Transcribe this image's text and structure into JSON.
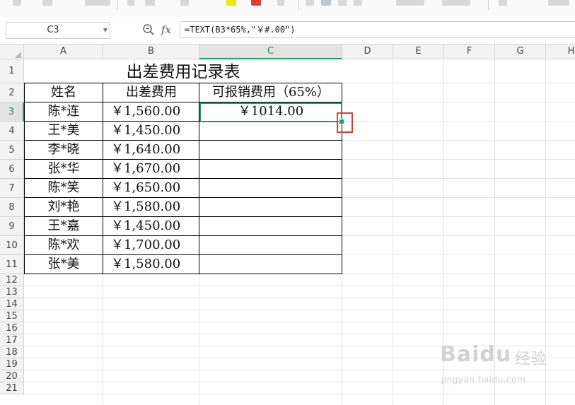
{
  "formula_bar": {
    "name_box": "C3",
    "fx_label": "fx",
    "formula": "=TEXT(B3*65%,\"￥#.00\")"
  },
  "columns": [
    "A",
    "B",
    "C",
    "D",
    "E",
    "F",
    "G",
    "H"
  ],
  "selected_column": "C",
  "rows": [
    "1",
    "2",
    "3",
    "4",
    "5",
    "6",
    "7",
    "8",
    "9",
    "10",
    "11",
    "12",
    "13",
    "14",
    "15",
    "16",
    "17",
    "18",
    "19",
    "20",
    "21"
  ],
  "selected_row": "3",
  "sheet": {
    "title": "出差费用记录表",
    "headers": [
      "姓名",
      "出差费用",
      "可报销费用（65%）"
    ],
    "records": [
      {
        "name": "陈*连",
        "cost": "￥1,560.00",
        "reimbursable": "￥1014.00"
      },
      {
        "name": "王*美",
        "cost": "￥1,450.00",
        "reimbursable": ""
      },
      {
        "name": "李*晓",
        "cost": "￥1,640.00",
        "reimbursable": ""
      },
      {
        "name": "张*华",
        "cost": "￥1,670.00",
        "reimbursable": ""
      },
      {
        "name": "陈*笑",
        "cost": "￥1,650.00",
        "reimbursable": ""
      },
      {
        "name": "刘*艳",
        "cost": "￥1,580.00",
        "reimbursable": ""
      },
      {
        "name": "王*嘉",
        "cost": "￥1,450.00",
        "reimbursable": ""
      },
      {
        "name": "陈*欢",
        "cost": "￥1,700.00",
        "reimbursable": ""
      },
      {
        "name": "张*美",
        "cost": "￥1,580.00",
        "reimbursable": ""
      }
    ]
  },
  "watermark": {
    "logo": "Baidu",
    "cn": "经验",
    "url": "jingyan.baidu.com"
  },
  "colors": {
    "selection": "#1aa160",
    "highlight_box": "#e53935"
  }
}
